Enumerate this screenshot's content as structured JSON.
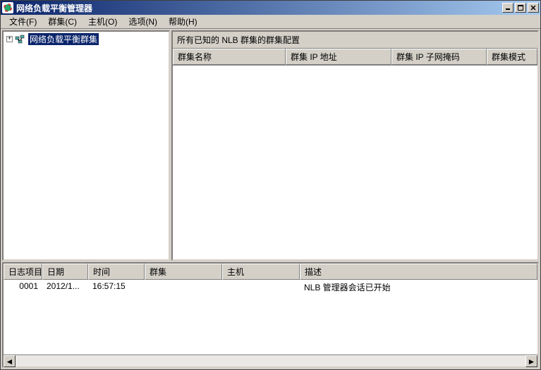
{
  "titlebar": {
    "title": "网络负载平衡管理器"
  },
  "menubar": {
    "file": "文件(F)",
    "cluster": "群集(C)",
    "host": "主机(O)",
    "options": "选项(N)",
    "help": "帮助(H)"
  },
  "tree": {
    "root_label": "网络负载平衡群集",
    "expander": "+"
  },
  "right": {
    "caption": "所有已知的 NLB 群集的群集配置",
    "columns": {
      "name": "群集名称",
      "ip": "群集 IP 地址",
      "mask": "群集 IP 子网掩码",
      "mode": "群集模式"
    }
  },
  "log": {
    "columns": {
      "item": "日志项目",
      "date": "日期",
      "time": "时间",
      "cluster": "群集",
      "host": "主机",
      "desc": "描述"
    },
    "col_widths": {
      "item": 55,
      "date": 65,
      "time": 80,
      "cluster": 110,
      "host": 110,
      "desc": 300
    },
    "rows": [
      {
        "item": "0001",
        "date": "2012/1...",
        "time": "16:57:15",
        "cluster": "",
        "host": "",
        "desc": "NLB 管理器会话已开始"
      }
    ]
  },
  "scrollbar": {
    "left": "◄",
    "right": "►"
  }
}
